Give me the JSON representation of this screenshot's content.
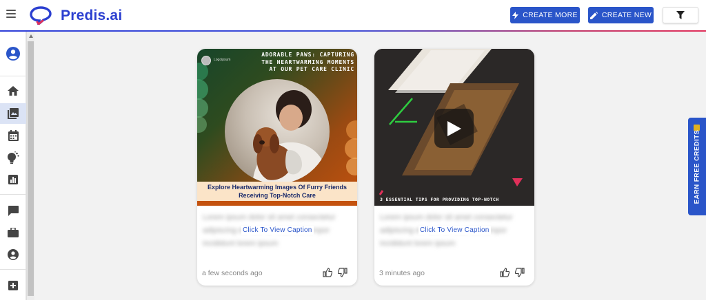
{
  "app": {
    "brand": "Predis.ai"
  },
  "toolbar": {
    "create_more_label": "CREATE MORE",
    "create_new_label": "CREATE NEW"
  },
  "posts": [
    {
      "media_title": "ADORABLE PAWS: CAPTURING THE HEARTWARMING MOMENTS AT OUR PET CARE CLINIC",
      "media_caption": "Explore Heartwarming Images Of Furry Friends Receiving Top-Notch Care",
      "media_logo_text": "Logoipsum",
      "caption_preview": "Lorem ipsum dolor sit amet consectetur adipiscing elit sed do eiusmod tempor incididunt lorem ipsum",
      "view_caption_label": "Click To View Caption",
      "timestamp": "a few seconds ago",
      "is_video": false
    },
    {
      "media_caption": "3 ESSENTIAL TIPS FOR PROVIDING TOP-NOTCH",
      "caption_preview": "Lorem ipsum dolor sit amet consectetur adipiscing elit sed do eiusmod tempor incididunt lorem ipsum",
      "view_caption_label": "Click To View Caption",
      "timestamp": "3 minutes ago",
      "is_video": true
    }
  ],
  "earn_credits": {
    "label": "EARN FREE CREDITS"
  },
  "colors": {
    "brand_blue": "#2b3fd0",
    "button_blue": "#2a55c9",
    "accent_red": "#e0305a"
  },
  "icons": {
    "menu": "hamburger-icon",
    "profile": "account-circle-icon",
    "home": "home-icon",
    "gallery": "image-gallery-icon",
    "calendar": "calendar-icon",
    "ideas": "lightbulb-icon",
    "analytics": "bar-chart-icon",
    "chat": "chat-bubble-icon",
    "briefcase": "briefcase-icon",
    "account": "account-icon",
    "add": "add-box-icon",
    "filter": "filter-icon"
  }
}
